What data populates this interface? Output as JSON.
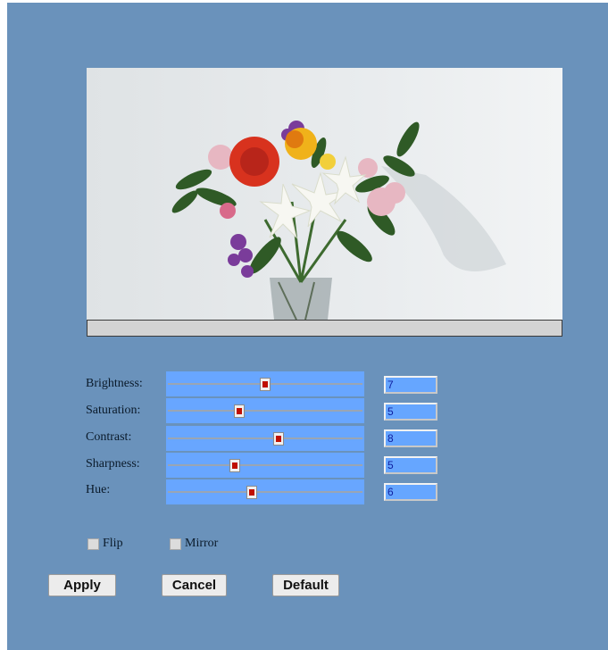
{
  "preview": {
    "image_description_icon": "flower-bouquet-image"
  },
  "controls": [
    {
      "label": "Brightness:",
      "value": "7",
      "level": 0.5
    },
    {
      "label": "Saturation:",
      "value": "5",
      "level": 0.36
    },
    {
      "label": "Contrast:",
      "value": "8",
      "level": 0.57
    },
    {
      "label": "Sharpness:",
      "value": "5",
      "level": 0.34
    },
    {
      "label": "Hue:",
      "value": "6",
      "level": 0.43
    }
  ],
  "options": {
    "flip_label": "Flip",
    "mirror_label": "Mirror"
  },
  "buttons": {
    "apply_label": "Apply",
    "cancel_label": "Cancel",
    "default_label": "Default"
  },
  "colors": {
    "panel_bg": "#6a92bb",
    "slider_bg": "#68a6ff",
    "thumb_marker": "#c01000"
  }
}
